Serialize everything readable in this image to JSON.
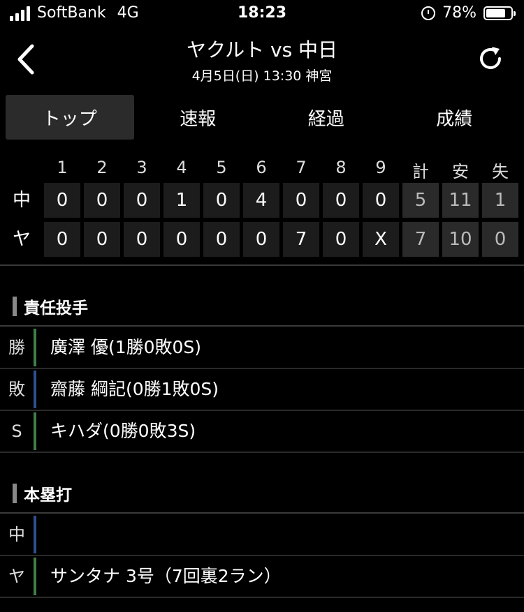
{
  "status": {
    "carrier": "SoftBank",
    "network": "4G",
    "time": "18:23",
    "battery": "78%",
    "battery_level": 0.78
  },
  "header": {
    "title": "ヤクルト vs 中日",
    "subtitle": "4月5日(日) 13:30 神宮"
  },
  "tabs": [
    {
      "label": "トップ"
    },
    {
      "label": "速報"
    },
    {
      "label": "経過"
    },
    {
      "label": "成績"
    }
  ],
  "scoreboard": {
    "headers": [
      "1",
      "2",
      "3",
      "4",
      "5",
      "6",
      "7",
      "8",
      "9",
      "計",
      "安",
      "失"
    ],
    "rows": [
      {
        "team": "中",
        "cells": [
          "0",
          "0",
          "0",
          "1",
          "0",
          "4",
          "0",
          "0",
          "0",
          "5",
          "11",
          "1"
        ]
      },
      {
        "team": "ヤ",
        "cells": [
          "0",
          "0",
          "0",
          "0",
          "0",
          "0",
          "7",
          "0",
          "X",
          "7",
          "10",
          "0"
        ]
      }
    ]
  },
  "pitchers": {
    "title": "責任投手",
    "rows": [
      {
        "label": "勝",
        "text": "廣澤 優(1勝0敗0S)",
        "color": "#3f7f4a"
      },
      {
        "label": "敗",
        "text": "齋藤 綱記(0勝1敗0S)",
        "color": "#2f4f8f"
      },
      {
        "label": "S",
        "text": "キハダ(0勝0敗3S)",
        "color": "#3f7f4a"
      }
    ]
  },
  "homeruns": {
    "title": "本塁打",
    "rows": [
      {
        "label": "中",
        "text": "",
        "color": "#2f4f8f"
      },
      {
        "label": "ヤ",
        "text": "サンタナ 3号（7回裏2ラン）",
        "color": "#3f7f4a"
      }
    ]
  }
}
